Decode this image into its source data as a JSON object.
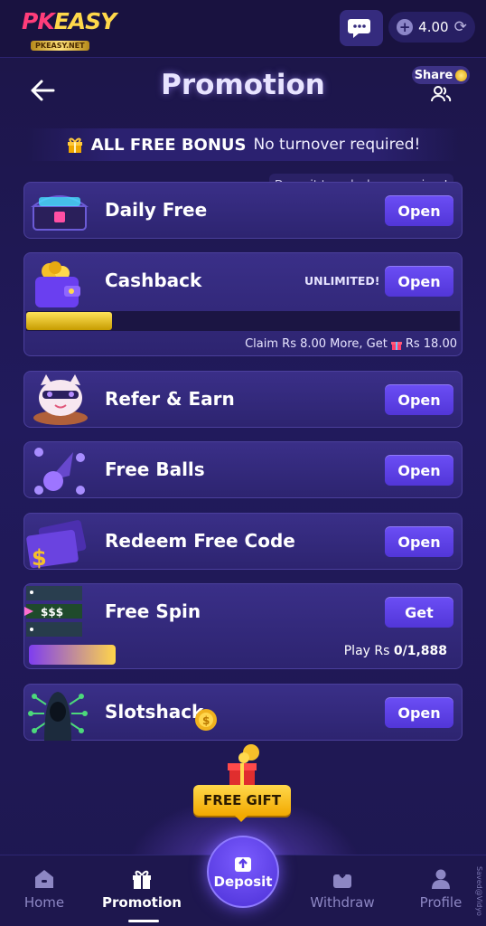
{
  "brand": {
    "name_part1": "PK",
    "name_part2": "EASY",
    "sub": "PKEASY.NET"
  },
  "header": {
    "balance": "4.00",
    "title": "Promotion",
    "share_label": "Share"
  },
  "bonus_banner": {
    "strong": "ALL FREE BONUS",
    "light": "No turnover required!"
  },
  "cards": {
    "daily_free": {
      "note": "Deposit to unlock more prizes!",
      "label": "Daily Free",
      "button": "Open"
    },
    "cashback": {
      "label": "Cashback",
      "badge": "UNLIMITED!",
      "button": "Open",
      "progress_fraction": 0.2,
      "claim_prefix": "Claim Rs 8.00 More, Get",
      "claim_suffix": "Rs 18.00"
    },
    "refer_earn": {
      "label": "Refer & Earn",
      "button": "Open"
    },
    "free_balls": {
      "label": "Free Balls",
      "button": "Open"
    },
    "redeem_code": {
      "label": "Redeem Free Code",
      "button": "Open"
    },
    "free_spin": {
      "label": "Free Spin",
      "button": "Get",
      "ticker": "$$$",
      "play_prefix": "Play Rs ",
      "play_value": "0/1,888"
    },
    "slotshack": {
      "label": "Slotshack",
      "button": "Open"
    }
  },
  "free_gift": "FREE GIFT",
  "nav": {
    "home": "Home",
    "promotion": "Promotion",
    "deposit": "Deposit",
    "withdraw": "Withdraw",
    "profile": "Profile"
  },
  "side_text": "Saved@Vidyo"
}
